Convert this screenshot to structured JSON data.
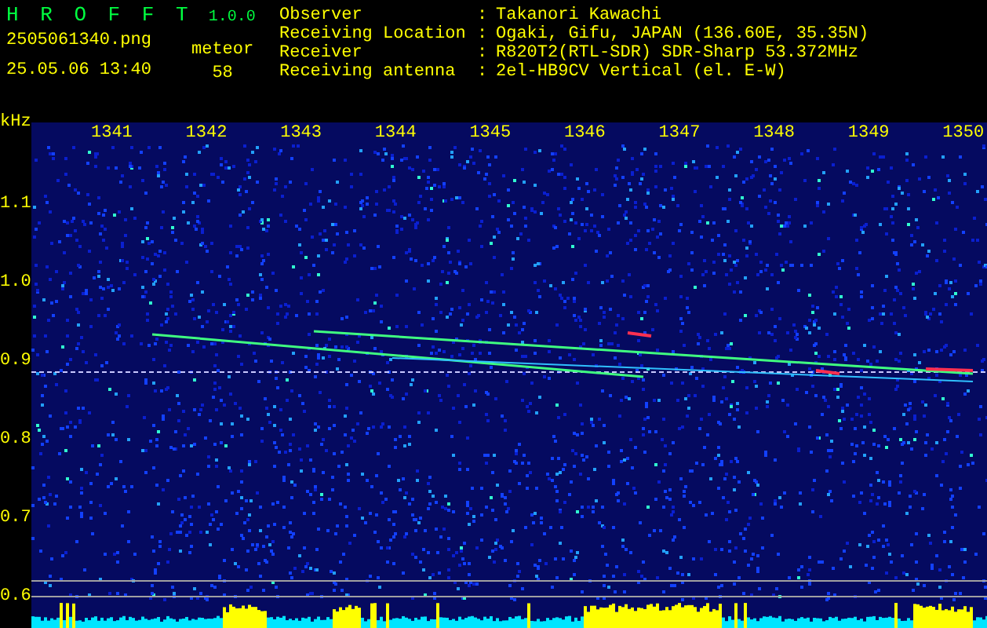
{
  "header": {
    "title": "H R O F F T",
    "version": "1.0.0",
    "filename": "2505061340.png",
    "datetime": "25.05.06 13:40",
    "counter_label": "meteor",
    "counter_value": "58"
  },
  "station": [
    {
      "label": "Observer",
      "separator": ":",
      "value": "Takanori Kawachi"
    },
    {
      "label": "Receiving Location",
      "separator": ":",
      "value": "Ogaki, Gifu, JAPAN (136.60E, 35.35N)"
    },
    {
      "label": "Receiver",
      "separator": ":",
      "value": "R820T2(RTL-SDR) SDR-Sharp 53.372MHz"
    },
    {
      "label": "Receiving antenna",
      "separator": ":",
      "value": "2el-HB9CV Vertical (el. E-W)"
    }
  ],
  "spectrogram": {
    "y_unit": "kHz",
    "x_ticks": [
      "1341",
      "1342",
      "1343",
      "1344",
      "1345",
      "1346",
      "1347",
      "1348",
      "1349",
      "1350"
    ],
    "y_ticks": [
      "1.1",
      "1.0",
      "0.9",
      "0.8",
      "0.7",
      "0.6"
    ]
  }
}
